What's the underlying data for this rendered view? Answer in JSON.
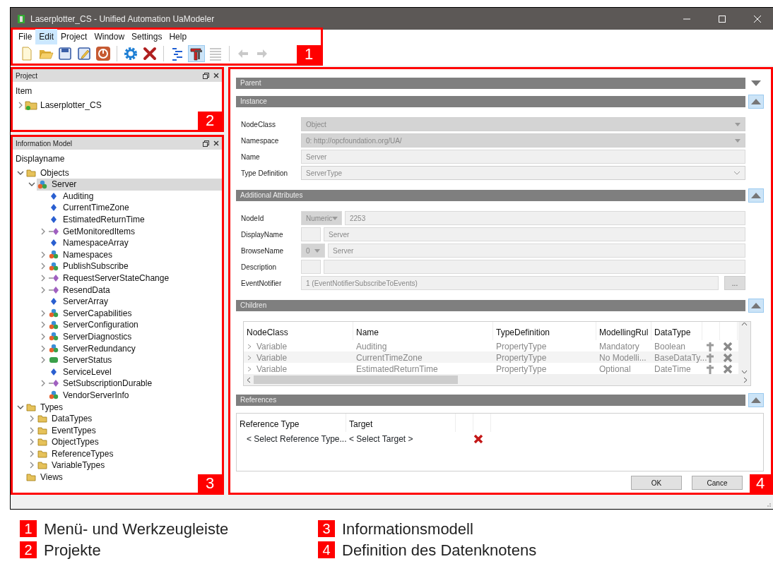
{
  "window": {
    "title": "Laserplotter_CS - Unified Automation UaModeler"
  },
  "menu": [
    {
      "label": "File",
      "selected": false
    },
    {
      "label": "Edit",
      "selected": true
    },
    {
      "label": "Project",
      "selected": false
    },
    {
      "label": "Window",
      "selected": false
    },
    {
      "label": "Settings",
      "selected": false
    },
    {
      "label": "Help",
      "selected": false
    }
  ],
  "toolbar": [
    {
      "kind": "new",
      "pressed": false,
      "disabled": false
    },
    {
      "kind": "open",
      "pressed": false,
      "disabled": false
    },
    {
      "kind": "save",
      "pressed": false,
      "disabled": false
    },
    {
      "kind": "edit",
      "pressed": false,
      "disabled": false
    },
    {
      "kind": "power",
      "pressed": false,
      "disabled": false
    },
    {
      "kind": "sep"
    },
    {
      "kind": "gear",
      "pressed": false,
      "disabled": false
    },
    {
      "kind": "delete",
      "pressed": false,
      "disabled": false
    },
    {
      "kind": "sep"
    },
    {
      "kind": "tree",
      "pressed": false,
      "disabled": false
    },
    {
      "kind": "type",
      "pressed": true,
      "disabled": false
    },
    {
      "kind": "list",
      "pressed": false,
      "disabled": true
    },
    {
      "kind": "sep"
    },
    {
      "kind": "back",
      "pressed": false,
      "disabled": true
    },
    {
      "kind": "forward",
      "pressed": false,
      "disabled": true
    }
  ],
  "callouts": [
    "1",
    "2",
    "3",
    "4"
  ],
  "project_panel": {
    "title": "Project",
    "column": "Item",
    "items": [
      {
        "label": "Laserplotter_CS",
        "kind": "project",
        "expanded": false,
        "selected": false
      }
    ]
  },
  "info_panel": {
    "title": "Information Model",
    "column": "Displayname",
    "items": [
      {
        "label": "Objects",
        "kind": "folder",
        "expanded": true,
        "selected": false,
        "children": [
          {
            "label": "Server",
            "kind": "object",
            "expanded": true,
            "selected": true,
            "children": [
              {
                "label": "Auditing",
                "kind": "variable",
                "selected": false
              },
              {
                "label": "CurrentTimeZone",
                "kind": "variable",
                "selected": false
              },
              {
                "label": "EstimatedReturnTime",
                "kind": "variable",
                "selected": false
              },
              {
                "label": "GetMonitoredItems",
                "kind": "method",
                "expanded": false,
                "selected": false
              },
              {
                "label": "NamespaceArray",
                "kind": "variable",
                "selected": false
              },
              {
                "label": "Namespaces",
                "kind": "object",
                "expanded": false,
                "selected": false
              },
              {
                "label": "PublishSubscribe",
                "kind": "object",
                "expanded": false,
                "selected": false
              },
              {
                "label": "RequestServerStateChange",
                "kind": "method",
                "expanded": false,
                "selected": false
              },
              {
                "label": "ResendData",
                "kind": "method",
                "expanded": false,
                "selected": false
              },
              {
                "label": "ServerArray",
                "kind": "variable",
                "selected": false
              },
              {
                "label": "ServerCapabilities",
                "kind": "object",
                "expanded": false,
                "selected": false
              },
              {
                "label": "ServerConfiguration",
                "kind": "object",
                "expanded": false,
                "selected": false
              },
              {
                "label": "ServerDiagnostics",
                "kind": "object",
                "expanded": false,
                "selected": false
              },
              {
                "label": "ServerRedundancy",
                "kind": "object",
                "expanded": false,
                "selected": false
              },
              {
                "label": "ServerStatus",
                "kind": "status",
                "expanded": false,
                "selected": false
              },
              {
                "label": "ServiceLevel",
                "kind": "variable",
                "selected": false
              },
              {
                "label": "SetSubscriptionDurable",
                "kind": "method",
                "expanded": false,
                "selected": false
              },
              {
                "label": "VendorServerInfo",
                "kind": "object",
                "selected": false
              }
            ]
          }
        ]
      },
      {
        "label": "Types",
        "kind": "folder",
        "expanded": true,
        "selected": false,
        "children": [
          {
            "label": "DataTypes",
            "kind": "folder",
            "expanded": false,
            "selected": false
          },
          {
            "label": "EventTypes",
            "kind": "folder",
            "expanded": false,
            "selected": false
          },
          {
            "label": "ObjectTypes",
            "kind": "folder",
            "expanded": false,
            "selected": false
          },
          {
            "label": "ReferenceTypes",
            "kind": "folder",
            "expanded": false,
            "selected": false
          },
          {
            "label": "VariableTypes",
            "kind": "folder",
            "expanded": false,
            "selected": false
          }
        ]
      },
      {
        "label": "Views",
        "kind": "folder",
        "selected": false
      }
    ]
  },
  "editor": {
    "sections": [
      {
        "title": "Parent",
        "expanded": false
      },
      {
        "title": "Instance",
        "kind": "form",
        "expanded": true,
        "fields": [
          {
            "label": "NodeClass",
            "kind": "select",
            "value": "Object"
          },
          {
            "label": "Namespace",
            "kind": "select",
            "value": "0: http://opcfoundation.org/UA/"
          },
          {
            "label": "Name",
            "kind": "text",
            "value": "Server"
          },
          {
            "label": "Type Definition",
            "kind": "combo",
            "value": "ServerType"
          }
        ]
      },
      {
        "title": "Additional Attributes",
        "kind": "form",
        "expanded": true,
        "fields": [
          {
            "label": "NodeId",
            "kind": "split-select",
            "prefix": "Numeric",
            "value": "2253"
          },
          {
            "label": "DisplayName",
            "kind": "split-box",
            "value": "Server"
          },
          {
            "label": "BrowseName",
            "kind": "split-select",
            "prefix": "0",
            "value": "Server"
          },
          {
            "label": "Description",
            "kind": "split-box"
          },
          {
            "label": "EventNotifier",
            "kind": "text-button",
            "value": "1 (EventNotifierSubscribeToEvents)",
            "button": "..."
          }
        ]
      },
      {
        "title": "Children",
        "kind": "children",
        "expanded": true,
        "columns": [
          "NodeClass",
          "Name",
          "TypeDefinition",
          "ModellingRul",
          "DataType"
        ],
        "rows": [
          [
            "Variable",
            "Auditing",
            "PropertyType",
            "Mandatory",
            "Boolean"
          ],
          [
            "Variable",
            "CurrentTimeZone",
            "PropertyType",
            "No Modelli...",
            "BaseDataTy..."
          ],
          [
            "Variable",
            "EstimatedReturnTime",
            "PropertyType",
            "Optional",
            "DateTime"
          ]
        ]
      },
      {
        "title": "References",
        "kind": "references",
        "expanded": true,
        "columns": [
          "Reference Type",
          "Target"
        ],
        "rows": [
          [
            "< Select Reference Type...",
            "< Select Target >"
          ]
        ]
      }
    ],
    "buttons": [
      "OK",
      "Cance"
    ]
  },
  "legend": [
    {
      "number": "1",
      "label": "Menü- und Werkzeugleiste"
    },
    {
      "number": "2",
      "label": "Projekte"
    },
    {
      "number": "3",
      "label": "Informationsmodell"
    },
    {
      "number": "4",
      "label": "Definition des Datenknotens"
    }
  ]
}
